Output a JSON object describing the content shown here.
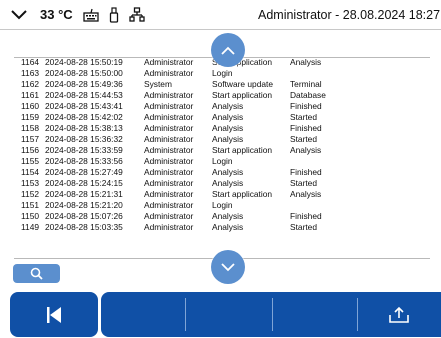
{
  "status": {
    "temperature": "33 °C",
    "user_date": "Administrator - 28.08.2024 18:27"
  },
  "icons": {
    "menu": "chevron-down-icon",
    "keyboard": "keyboard-icon",
    "usb": "usb-icon",
    "network": "network-icon",
    "scroll_up": "chevron-up-icon",
    "scroll_down": "chevron-down-icon",
    "search": "search-icon",
    "back": "skip-back-icon",
    "export": "upload-icon"
  },
  "colors": {
    "primary": "#1050a6",
    "accent": "#5b8fce"
  },
  "log": [
    {
      "id": "1164",
      "timestamp": "2024-08-28 15:50:19",
      "user": "Administrator",
      "action": "Start application",
      "detail": "Analysis"
    },
    {
      "id": "1163",
      "timestamp": "2024-08-28 15:50:00",
      "user": "Administrator",
      "action": "Login",
      "detail": ""
    },
    {
      "id": "1162",
      "timestamp": "2024-08-28 15:49:36",
      "user": "System",
      "action": "Software update",
      "detail": "Terminal"
    },
    {
      "id": "1161",
      "timestamp": "2024-08-28 15:44:53",
      "user": "Administrator",
      "action": "Start application",
      "detail": "Database"
    },
    {
      "id": "1160",
      "timestamp": "2024-08-28 15:43:41",
      "user": "Administrator",
      "action": "Analysis",
      "detail": "Finished"
    },
    {
      "id": "1159",
      "timestamp": "2024-08-28 15:42:02",
      "user": "Administrator",
      "action": "Analysis",
      "detail": "Started"
    },
    {
      "id": "1158",
      "timestamp": "2024-08-28 15:38:13",
      "user": "Administrator",
      "action": "Analysis",
      "detail": "Finished"
    },
    {
      "id": "1157",
      "timestamp": "2024-08-28 15:36:32",
      "user": "Administrator",
      "action": "Analysis",
      "detail": "Started"
    },
    {
      "id": "1156",
      "timestamp": "2024-08-28 15:33:59",
      "user": "Administrator",
      "action": "Start application",
      "detail": "Analysis"
    },
    {
      "id": "1155",
      "timestamp": "2024-08-28 15:33:56",
      "user": "Administrator",
      "action": "Login",
      "detail": ""
    },
    {
      "id": "1154",
      "timestamp": "2024-08-28 15:27:49",
      "user": "Administrator",
      "action": "Analysis",
      "detail": "Finished"
    },
    {
      "id": "1153",
      "timestamp": "2024-08-28 15:24:15",
      "user": "Administrator",
      "action": "Analysis",
      "detail": "Started"
    },
    {
      "id": "1152",
      "timestamp": "2024-08-28 15:21:31",
      "user": "Administrator",
      "action": "Start application",
      "detail": "Analysis"
    },
    {
      "id": "1151",
      "timestamp": "2024-08-28 15:21:20",
      "user": "Administrator",
      "action": "Login",
      "detail": ""
    },
    {
      "id": "1150",
      "timestamp": "2024-08-28 15:07:26",
      "user": "Administrator",
      "action": "Analysis",
      "detail": "Finished"
    },
    {
      "id": "1149",
      "timestamp": "2024-08-28 15:03:35",
      "user": "Administrator",
      "action": "Analysis",
      "detail": "Started"
    }
  ]
}
